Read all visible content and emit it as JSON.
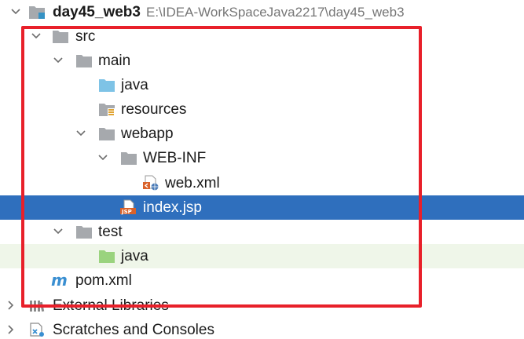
{
  "project": {
    "name": "day45_web3",
    "path": "E:\\IDEA-WorkSpaceJava2217\\day45_web3"
  },
  "tree": {
    "src": "src",
    "main": "main",
    "main_java": "java",
    "resources": "resources",
    "webapp": "webapp",
    "web_inf": "WEB-INF",
    "web_xml": "web.xml",
    "index_jsp": "index.jsp",
    "test": "test",
    "test_java": "java",
    "pom": "pom.xml",
    "external_libraries": "External Libraries",
    "scratches": "Scratches and Consoles"
  },
  "icons": {
    "folder": "folder-icon",
    "source_folder": "source-root-folder-icon",
    "resources_folder": "resources-root-folder-icon",
    "test_folder": "test-root-folder-icon",
    "xml_file": "xml-file-icon",
    "jsp_file": "jsp-file-icon",
    "maven": "maven-icon",
    "libraries": "libraries-icon",
    "scratches": "scratches-icon"
  },
  "colors": {
    "selection": "#2f6fbd",
    "annotation": "#e8202a",
    "source_folder": "#7ec3e6",
    "test_folder": "#9ad37e",
    "folder": "#a6a9ad"
  }
}
